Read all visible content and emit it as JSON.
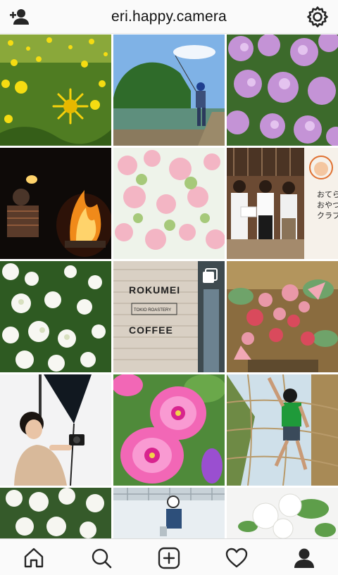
{
  "header": {
    "username": "eri.happy.camera",
    "add_person_icon": "add-person-icon",
    "settings_icon": "gear-icon"
  },
  "grid": {
    "tiles": [
      {
        "subject": "yellow dandelion field"
      },
      {
        "subject": "child fishing by lake"
      },
      {
        "subject": "pink lilac flowers"
      },
      {
        "subject": "campfire at night"
      },
      {
        "subject": "pink cherry blossoms"
      },
      {
        "subject": "three people with sign"
      },
      {
        "subject": "white spirea flowers"
      },
      {
        "subject": "cafe wall sign",
        "multi_photo": true
      },
      {
        "subject": "red and pink flower bouquet"
      },
      {
        "subject": "woman with camera"
      },
      {
        "subject": "pink gerbera flowers"
      },
      {
        "subject": "child climbing"
      },
      {
        "subject": "white flowers"
      },
      {
        "subject": "child cycling"
      },
      {
        "subject": "white bouquet"
      }
    ],
    "texts": {
      "sign_line1": "ROKUMEI",
      "sign_line2": "TOKIO ROASTERY",
      "sign_line3": "COFFEE",
      "banner_jp_1": "おてら",
      "banner_jp_2": "おやつ",
      "banner_jp_3": "クラブ"
    }
  },
  "tabbar": {
    "items": [
      {
        "name": "home-icon"
      },
      {
        "name": "search-icon"
      },
      {
        "name": "add-post-icon"
      },
      {
        "name": "heart-icon"
      },
      {
        "name": "profile-icon"
      }
    ]
  },
  "colors": {
    "bar_background": "#fafafa",
    "border": "#dbdbdb",
    "icon": "#262626"
  }
}
